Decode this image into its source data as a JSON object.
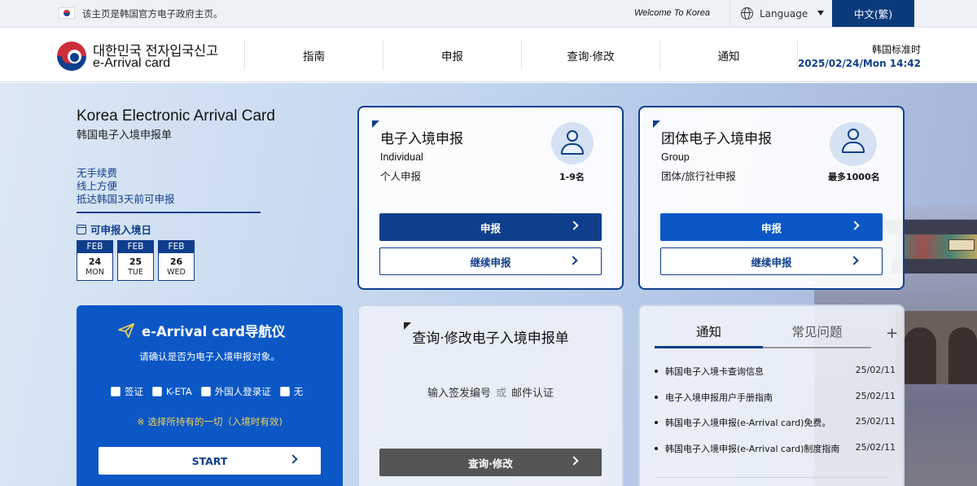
{
  "topbar": {
    "gov_note": "该主页是韩国官方电子政府主页。",
    "welcome": "Welcome To Korea",
    "language_label": "Language",
    "lang_button": "中文(繁)"
  },
  "header": {
    "logo_kr": "대한민국 전자입국신고",
    "logo_en": "e-Arrival card",
    "nav": [
      "指南",
      "申报",
      "查询·修改",
      "通知"
    ],
    "time_label": "韩国标准时",
    "time_value": "2025/02/24/Mon 14:42"
  },
  "hero": {
    "title": "Korea Electronic Arrival Card",
    "subtitle": "韩国电子入境申报单",
    "features": [
      "无手续费",
      "线上方便",
      "抵达韩国3天前可申报"
    ],
    "available_label": "可申报入境日",
    "dates": [
      {
        "month": "FEB",
        "day": "24",
        "weekday": "MON"
      },
      {
        "month": "FEB",
        "day": "25",
        "weekday": "TUE"
      },
      {
        "month": "FEB",
        "day": "26",
        "weekday": "WED"
      }
    ]
  },
  "individual_card": {
    "title": "电子入境申报",
    "sub_en": "Individual",
    "sub_cn": "个人申报",
    "count": "1-9名",
    "apply_label": "申报",
    "continue_label": "继续申报"
  },
  "group_card": {
    "title": "团体电子入境申报",
    "sub_en": "Group",
    "sub_cn": "团体/旅行社申报",
    "count": "最多1000名",
    "apply_label": "申报",
    "continue_label": "继续申报"
  },
  "navigator": {
    "title": "e-Arrival card导航仪",
    "question": "请确认是否为电子入境申报对象。",
    "options": [
      "签证",
      "K-ETA",
      "外国人登录证",
      "无"
    ],
    "hint": "※ 选择所持有的一切（入境时有效)",
    "start_label": "START"
  },
  "inquiry": {
    "title": "查询·修改电子入境申报单",
    "desc_left": "输入签发编号",
    "desc_or": "或",
    "desc_right": "邮件认证",
    "button_label": "查询·修改"
  },
  "notice": {
    "tab_active": "通知",
    "tab_inactive": "常见问题",
    "more": "+",
    "items": [
      {
        "text": "韩国电子入境卡查询信息",
        "date": "25/02/11"
      },
      {
        "text": "电子入境申报用户手册指南",
        "date": "25/02/11"
      },
      {
        "text": "韩国电子入境申报(e-Arrival card)免费。",
        "date": "25/02/11"
      },
      {
        "text": "韩国电子入境申报(e-Arrival card)制度指南",
        "date": "25/02/11"
      }
    ]
  },
  "colors": {
    "navy": "#0f3f8c",
    "blue": "#0b57c6",
    "highlight": "#f3d354"
  }
}
